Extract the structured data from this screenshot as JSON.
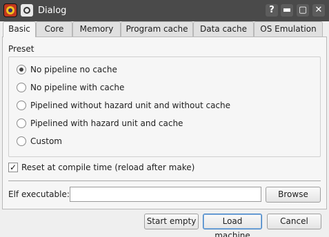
{
  "window": {
    "title": "Dialog",
    "controls": {
      "help": "?",
      "minimize": "▬",
      "maximize": "▢",
      "close": "✕"
    }
  },
  "tabs": [
    {
      "label": "Basic",
      "active": true
    },
    {
      "label": "Core"
    },
    {
      "label": "Memory"
    },
    {
      "label": "Program cache"
    },
    {
      "label": "Data cache"
    },
    {
      "label": "OS Emulation"
    }
  ],
  "preset": {
    "label": "Preset",
    "options": [
      {
        "label": "No pipeline no cache",
        "checked": true
      },
      {
        "label": "No pipeline with cache",
        "checked": false
      },
      {
        "label": "Pipelined without hazard unit and without cache",
        "checked": false
      },
      {
        "label": "Pipelined with hazard unit and cache",
        "checked": false
      },
      {
        "label": "Custom",
        "checked": false
      }
    ]
  },
  "reset": {
    "label": "Reset at compile time (reload after make)",
    "checked": true,
    "mark": "✓"
  },
  "elf": {
    "label": "Elf executable:",
    "value": "",
    "browse_label": "Browse"
  },
  "buttons": {
    "start_empty": "Start empty",
    "load_machine": "Load machine",
    "cancel": "Cancel"
  }
}
